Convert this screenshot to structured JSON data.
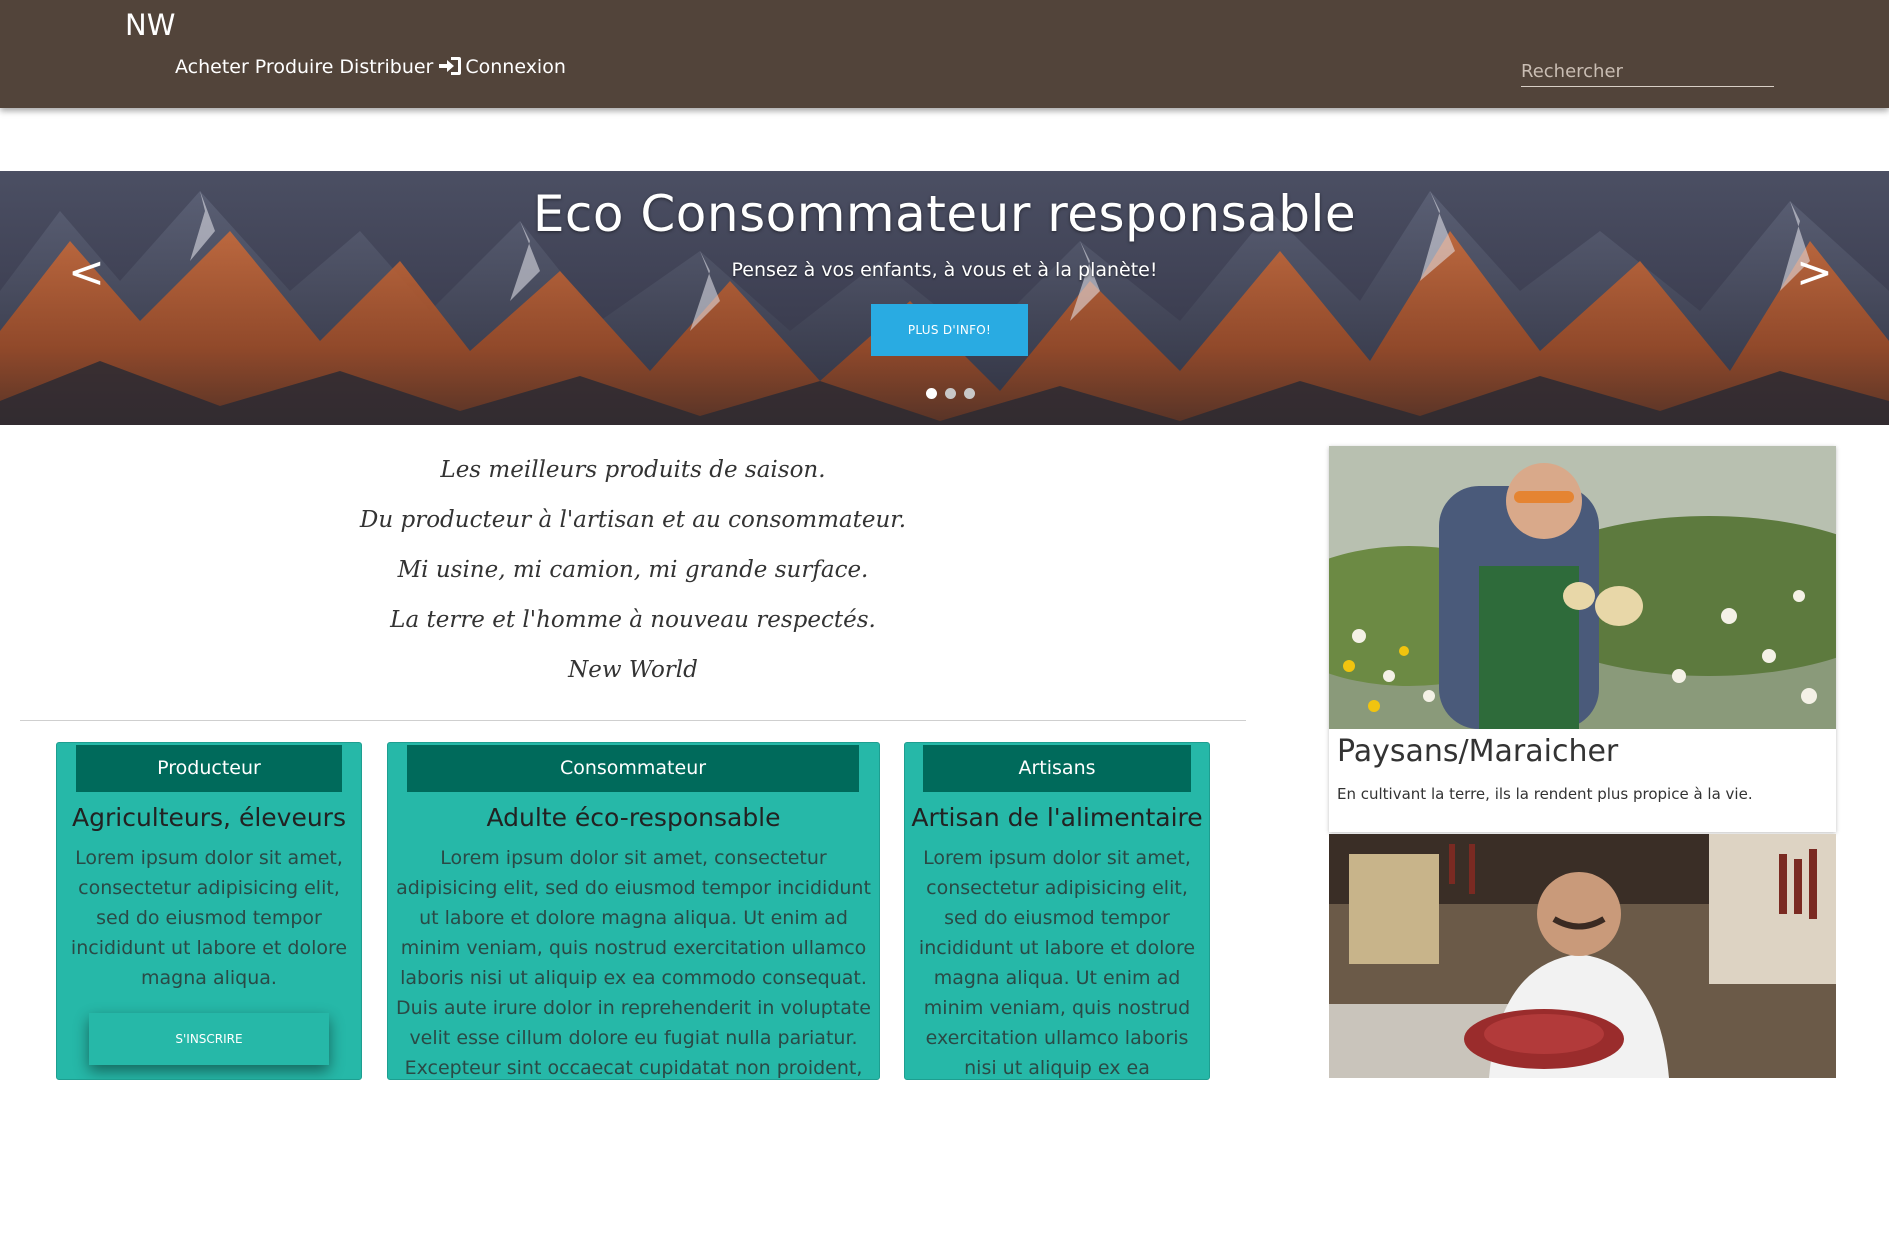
{
  "navbar": {
    "brand": "NW",
    "links": [
      "Acheter",
      "Produire",
      "Distribuer"
    ],
    "login_label": "Connexion",
    "search_placeholder": "Rechercher"
  },
  "hero": {
    "title": "Eco Consommateur responsable",
    "subtitle": "Pensez à vos enfants, à vous et à la planète!",
    "button_label": "PLUS D'INFO!",
    "prev_label": "<",
    "next_label": ">",
    "slide_count": 3,
    "active_slide": 1
  },
  "quote": {
    "lines": [
      "Les meilleurs produits de saison.",
      "Du producteur à l'artisan et au consommateur.",
      "Mi usine, mi camion, mi grande surface.",
      "La terre et l'homme à nouveau respectés.",
      "New World"
    ]
  },
  "cards": [
    {
      "header": "Producteur",
      "title": "Agriculteurs, éleveurs",
      "text": [
        "Lorem ipsum dolor sit amet,",
        "consectetur adipisicing elit,",
        "sed do eiusmod tempor",
        "incididunt ut labore et dolore",
        "magna aliqua."
      ],
      "button_label": "S'INSCRIRE"
    },
    {
      "header": "Consommateur",
      "title": "Adulte éco-responsable",
      "text": [
        "Lorem ipsum dolor sit amet, consectetur",
        "adipisicing elit, sed do eiusmod tempor incididunt",
        "ut labore et dolore magna aliqua. Ut enim ad",
        "minim veniam, quis nostrud exercitation ullamco",
        "laboris nisi ut aliquip ex ea commodo consequat.",
        "Duis aute irure dolor in reprehenderit in voluptate",
        "velit esse cillum dolore eu fugiat nulla pariatur.",
        "Excepteur sint occaecat cupidatat non proident,"
      ]
    },
    {
      "header": "Artisans",
      "title": "Artisan de l'alimentaire",
      "text": [
        "Lorem ipsum dolor sit amet,",
        "consectetur adipisicing elit,",
        "sed do eiusmod tempor",
        "incididunt ut labore et dolore",
        "magna aliqua. Ut enim ad",
        "minim veniam, quis nostrud",
        "exercitation ullamco laboris",
        "nisi ut aliquip ex ea"
      ]
    }
  ],
  "sidebar": {
    "feature": {
      "caption": "Paysans/Maraicher",
      "description": "En cultivant la terre, ils la rendent plus propice à la vie."
    }
  },
  "colors": {
    "navbar": "#52443a",
    "accent_blue": "#29abe2",
    "card_teal": "#26b8a8",
    "card_header": "#006a5b"
  },
  "icons": {
    "login": "sign-in-icon"
  }
}
